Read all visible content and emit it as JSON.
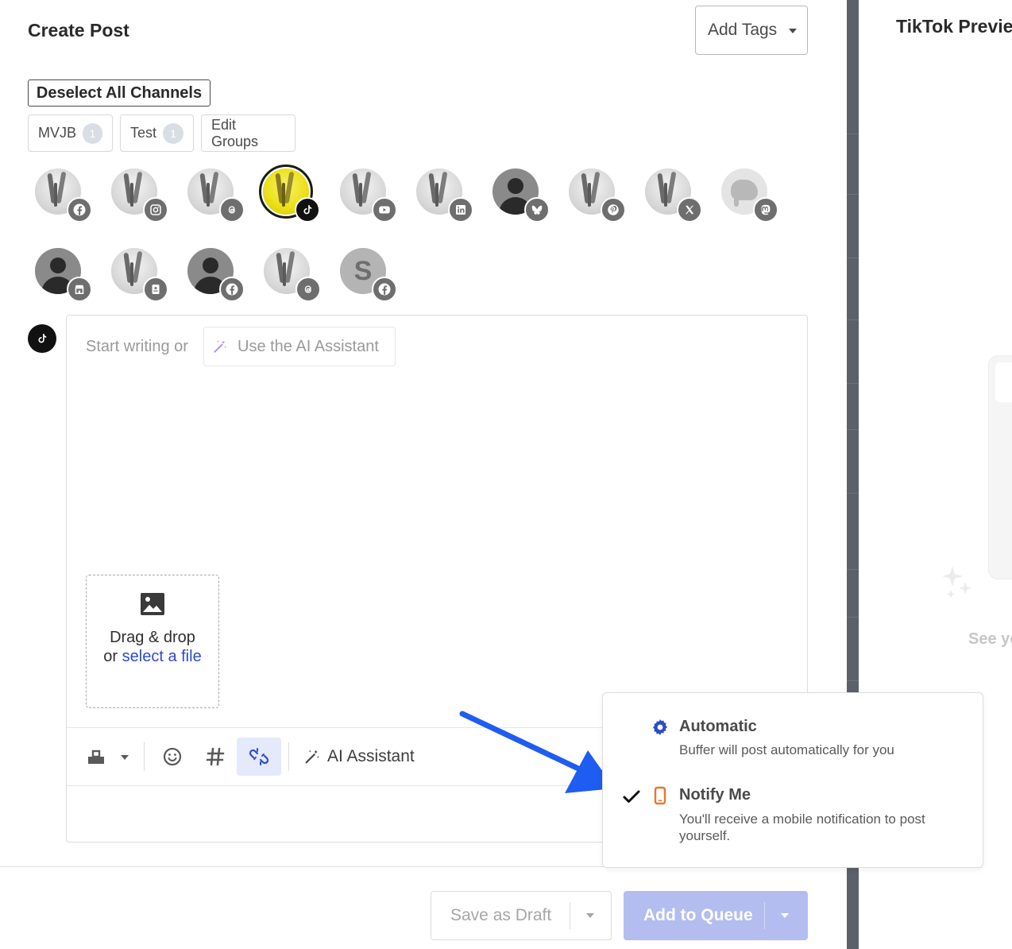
{
  "composer": {
    "title": "Create Post",
    "add_tags_label": "Add Tags",
    "deselect_label": "Deselect All Channels",
    "groups": [
      {
        "label": "MVJB",
        "count": "1"
      },
      {
        "label": "Test",
        "count": "1"
      },
      {
        "label": "Edit Groups"
      }
    ],
    "channels_row1": [
      {
        "network": "facebook-icon",
        "selected": false
      },
      {
        "network": "instagram-icon",
        "selected": false
      },
      {
        "network": "threads-icon",
        "selected": false
      },
      {
        "network": "tiktok-icon",
        "selected": true
      },
      {
        "network": "youtube-icon",
        "selected": false
      },
      {
        "network": "linkedin-icon",
        "selected": false
      },
      {
        "network": "bluesky-icon",
        "selected": false
      },
      {
        "network": "pinterest-icon",
        "selected": false
      },
      {
        "network": "x-icon",
        "selected": false
      },
      {
        "network": "mastodon-icon",
        "selected": false
      }
    ],
    "channels_row2": [
      {
        "network": "google-business-icon",
        "selected": false
      },
      {
        "network": "startpage-icon",
        "selected": false
      },
      {
        "network": "facebook-icon",
        "selected": false
      },
      {
        "network": "threads-icon",
        "selected": false
      },
      {
        "network": "facebook-icon",
        "selected": false,
        "avatar_letter": "S"
      }
    ],
    "editor": {
      "placeholder": "Start writing or",
      "ai_chip_label": "Use the AI Assistant",
      "dropzone_line1": "Drag & drop",
      "dropzone_or": "or",
      "dropzone_link": "select a file"
    },
    "toolbar": {
      "ai_assistant_label": "AI Assistant"
    },
    "footer": {
      "save_draft_label": "Save as Draft",
      "add_queue_label": "Add to Queue"
    }
  },
  "preview": {
    "title": "TikTok Preview",
    "see_text": "See yo"
  },
  "publish_menu": {
    "items": [
      {
        "name": "Automatic",
        "desc": "Buffer will post automatically for you",
        "icon": "gear-icon",
        "checked": false
      },
      {
        "name": "Notify Me",
        "desc": "You'll receive a mobile notification to post yourself.",
        "icon": "mobile-phone-icon",
        "checked": true
      }
    ]
  },
  "colors": {
    "accent": "#2c4bd0",
    "arrow": "#1f5cf2",
    "queue_button": "#b4bdf0",
    "notify_icon": "#e9772a"
  }
}
